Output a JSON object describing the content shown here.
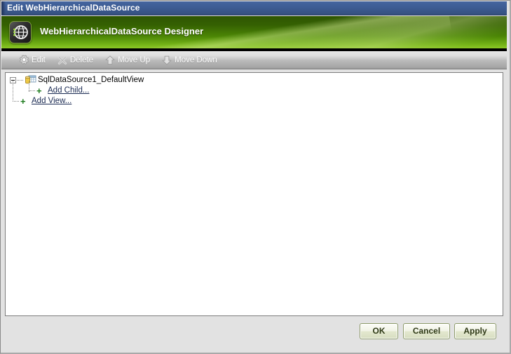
{
  "window": {
    "title": "Edit WebHierarchicalDataSource"
  },
  "header": {
    "title": "WebHierarchicalDataSource Designer",
    "logo_icon": "globe-logo-icon"
  },
  "toolbar": {
    "items": [
      {
        "label": "Edit",
        "icon": "gear-icon"
      },
      {
        "label": "Delete",
        "icon": "x-delete-icon"
      },
      {
        "label": "Move Up",
        "icon": "arrow-up-icon"
      },
      {
        "label": "Move Down",
        "icon": "arrow-down-icon"
      }
    ]
  },
  "tree": {
    "root": {
      "label": "SqlDataSource1_DefaultView",
      "icon": "database-table-icon",
      "expanded": true,
      "child_link": {
        "label": "Add Child...",
        "glyph": "+"
      }
    },
    "add_view_link": {
      "label": "Add View...",
      "glyph": "+"
    }
  },
  "footer": {
    "buttons": [
      {
        "label": "OK"
      },
      {
        "label": "Cancel"
      },
      {
        "label": "Apply"
      }
    ]
  },
  "colors": {
    "titlebar_blue": "#3d5c93",
    "header_green_dark": "#2e5401",
    "header_green_light": "#8cc727",
    "link_navy": "#1a2a52",
    "plus_green": "#1c7a1c",
    "button_border_olive": "#8d9b6a"
  }
}
